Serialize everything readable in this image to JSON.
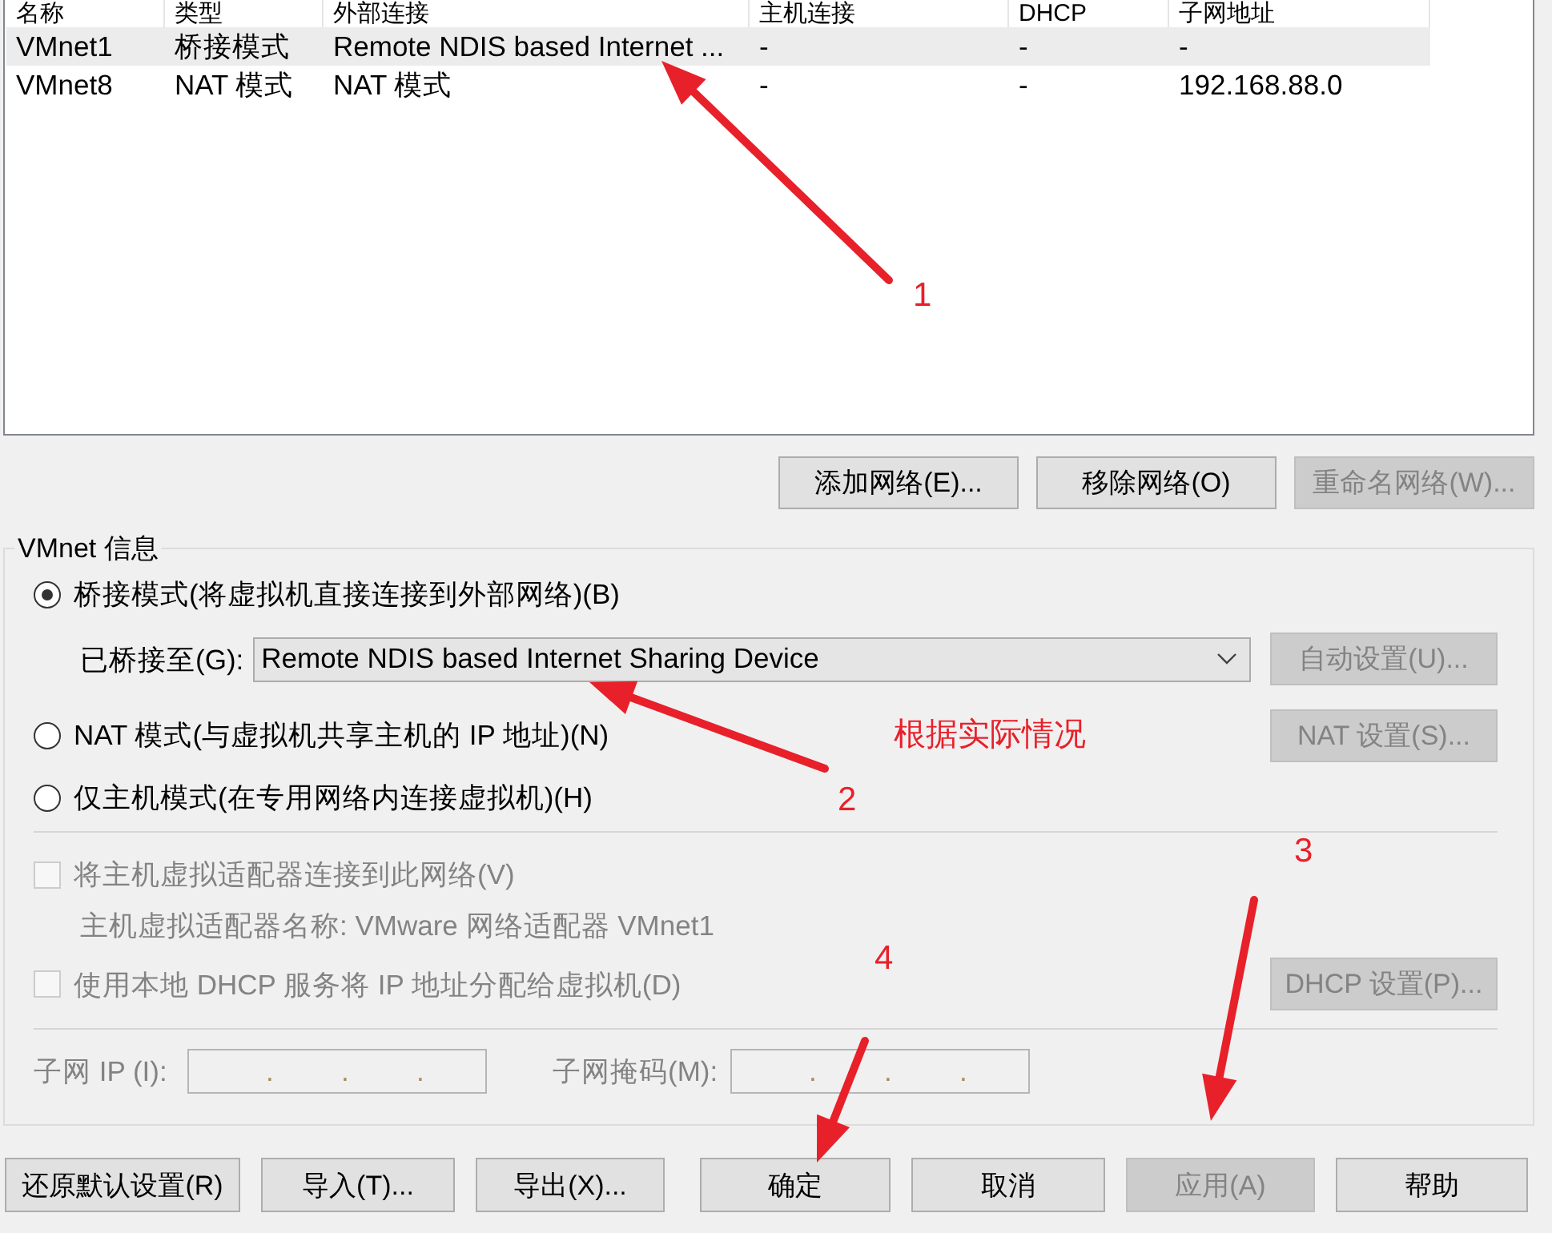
{
  "network_list": {
    "columns": [
      "名称",
      "类型",
      "外部连接",
      "主机连接",
      "DHCP",
      "子网地址"
    ],
    "rows": [
      {
        "cells": [
          "VMnet1",
          "桥接模式",
          "Remote NDIS based Internet ...",
          "-",
          "-",
          "-"
        ],
        "selected": true
      },
      {
        "cells": [
          "VMnet8",
          "NAT 模式",
          "NAT 模式",
          "-",
          "-",
          "192.168.88.0"
        ],
        "selected": false
      }
    ]
  },
  "list_buttons": [
    {
      "label": "添加网络(E)...",
      "disabled": false
    },
    {
      "label": "移除网络(O)",
      "disabled": false
    },
    {
      "label": "重命名网络(W)...",
      "disabled": true
    }
  ],
  "vmnet_info": {
    "title": "VMnet 信息",
    "modes": [
      {
        "label": "桥接模式(将虚拟机直接连接到外部网络)(B)",
        "selected": true,
        "bridge": {
          "label": "已桥接至(G):",
          "value": "Remote NDIS based Internet Sharing Device",
          "button": {
            "label": "自动设置(U)...",
            "disabled": true
          }
        }
      },
      {
        "label": "NAT 模式(与虚拟机共享主机的 IP 地址)(N)",
        "selected": false,
        "button": {
          "label": "NAT 设置(S)...",
          "disabled": true
        }
      },
      {
        "label": "仅主机模式(在专用网络内连接虚拟机)(H)",
        "selected": false
      }
    ],
    "host_adapter": {
      "checkbox": {
        "label": "将主机虚拟适配器连接到此网络(V)",
        "checked": false,
        "disabled": true
      },
      "adapter_name": "主机虚拟适配器名称: VMware 网络适配器 VMnet1"
    },
    "dhcp": {
      "checkbox": {
        "label": "使用本地 DHCP 服务将 IP 地址分配给虚拟机(D)",
        "checked": false,
        "disabled": true
      },
      "button": {
        "label": "DHCP 设置(P)...",
        "disabled": true
      }
    },
    "subnet": [
      {
        "label": "子网 IP (I):",
        "dots": [
          ".",
          ".",
          "."
        ],
        "disabled": true
      },
      {
        "label": "子网掩码(M):",
        "dots": [
          ".",
          ".",
          "."
        ],
        "disabled": true
      }
    ]
  },
  "dialog_buttons": [
    {
      "label": "还原默认设置(R)",
      "disabled": false
    },
    {
      "label": "导入(T)...",
      "disabled": false
    },
    {
      "label": "导出(X)...",
      "disabled": false
    },
    {
      "label": "确定",
      "disabled": false
    },
    {
      "label": "取消",
      "disabled": false
    },
    {
      "label": "应用(A)",
      "disabled": true
    },
    {
      "label": "帮助",
      "disabled": false
    }
  ],
  "annotations": {
    "arrows": [
      {
        "label": "1"
      },
      {
        "label": "2"
      },
      {
        "label": "3"
      },
      {
        "label": "4"
      }
    ],
    "note": "根据实际情况"
  }
}
